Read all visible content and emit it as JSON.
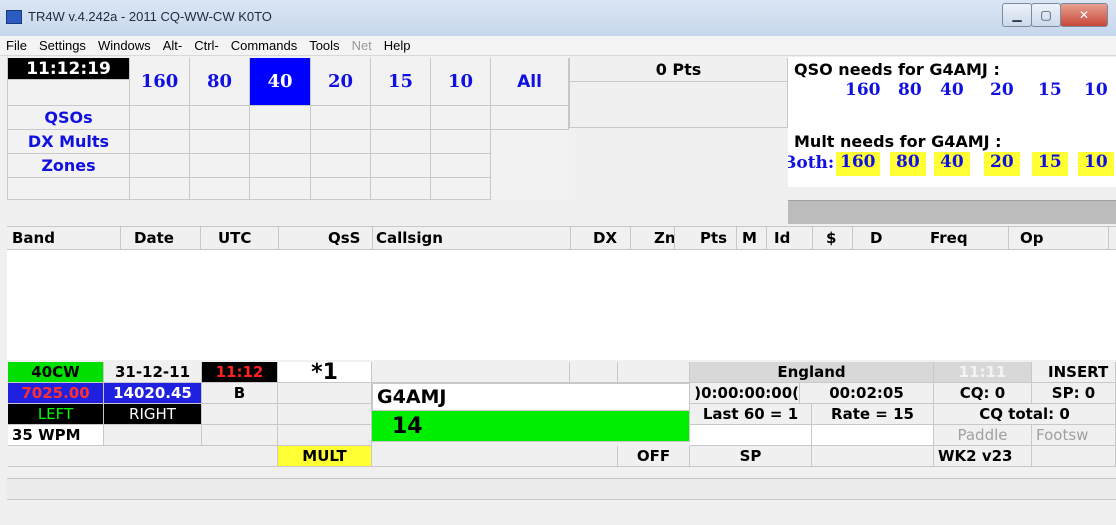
{
  "window": {
    "title": "TR4W v.4.242a - 2011 CQ-WW-CW K0TO"
  },
  "menu": [
    "File",
    "Settings",
    "Windows",
    "Alt-",
    "Ctrl-",
    "Commands",
    "Tools",
    "Net",
    "Help"
  ],
  "clock": "11:12:19",
  "bands": [
    "160",
    "80",
    "40",
    "20",
    "15",
    "10",
    "All"
  ],
  "active_band": "40",
  "summary_rows": [
    "QSOs",
    "DX Mults",
    "Zones"
  ],
  "points": "0 Pts",
  "qso_needs": {
    "label": "QSO needs for G4AMJ :",
    "bands": [
      "160",
      "80",
      "40",
      "20",
      "15",
      "10"
    ]
  },
  "mult_needs": {
    "label": "Mult needs for G4AMJ :",
    "prefix": "Both:",
    "bands": [
      "160",
      "80",
      "40",
      "20",
      "15",
      "10"
    ]
  },
  "log_columns": [
    "Band",
    "Date",
    "UTC",
    "QsS",
    "Callsign",
    "DX",
    "Zn",
    "Pts",
    "M",
    "Id",
    "$",
    "D",
    "Freq",
    "Op"
  ],
  "status": {
    "band_mode": "40CW",
    "date": "31-12-11",
    "time": "11:12",
    "serial": "*1",
    "freq_left": "7025.00",
    "freq_right": "14020.45",
    "vfo": "B",
    "left": "LEFT",
    "right": "RIGHT",
    "wpm": "35 WPM",
    "mult": "MULT",
    "off": "OFF",
    "sp": "SP",
    "country": "England",
    "dim_time": "11:11",
    "insert": "INSERT",
    "timer1": ")0:00:00:00(",
    "timer2": "00:02:05",
    "cq": "CQ: 0",
    "sp_count": "SP: 0",
    "last60": "Last 60 = 1",
    "rate": "Rate = 15",
    "cq_total": "CQ total: 0",
    "paddle": "Paddle",
    "footsw": "Footsw",
    "wk2": "WK2 v23"
  },
  "entry": {
    "callsign": "G4AMJ",
    "exchange": "14"
  }
}
